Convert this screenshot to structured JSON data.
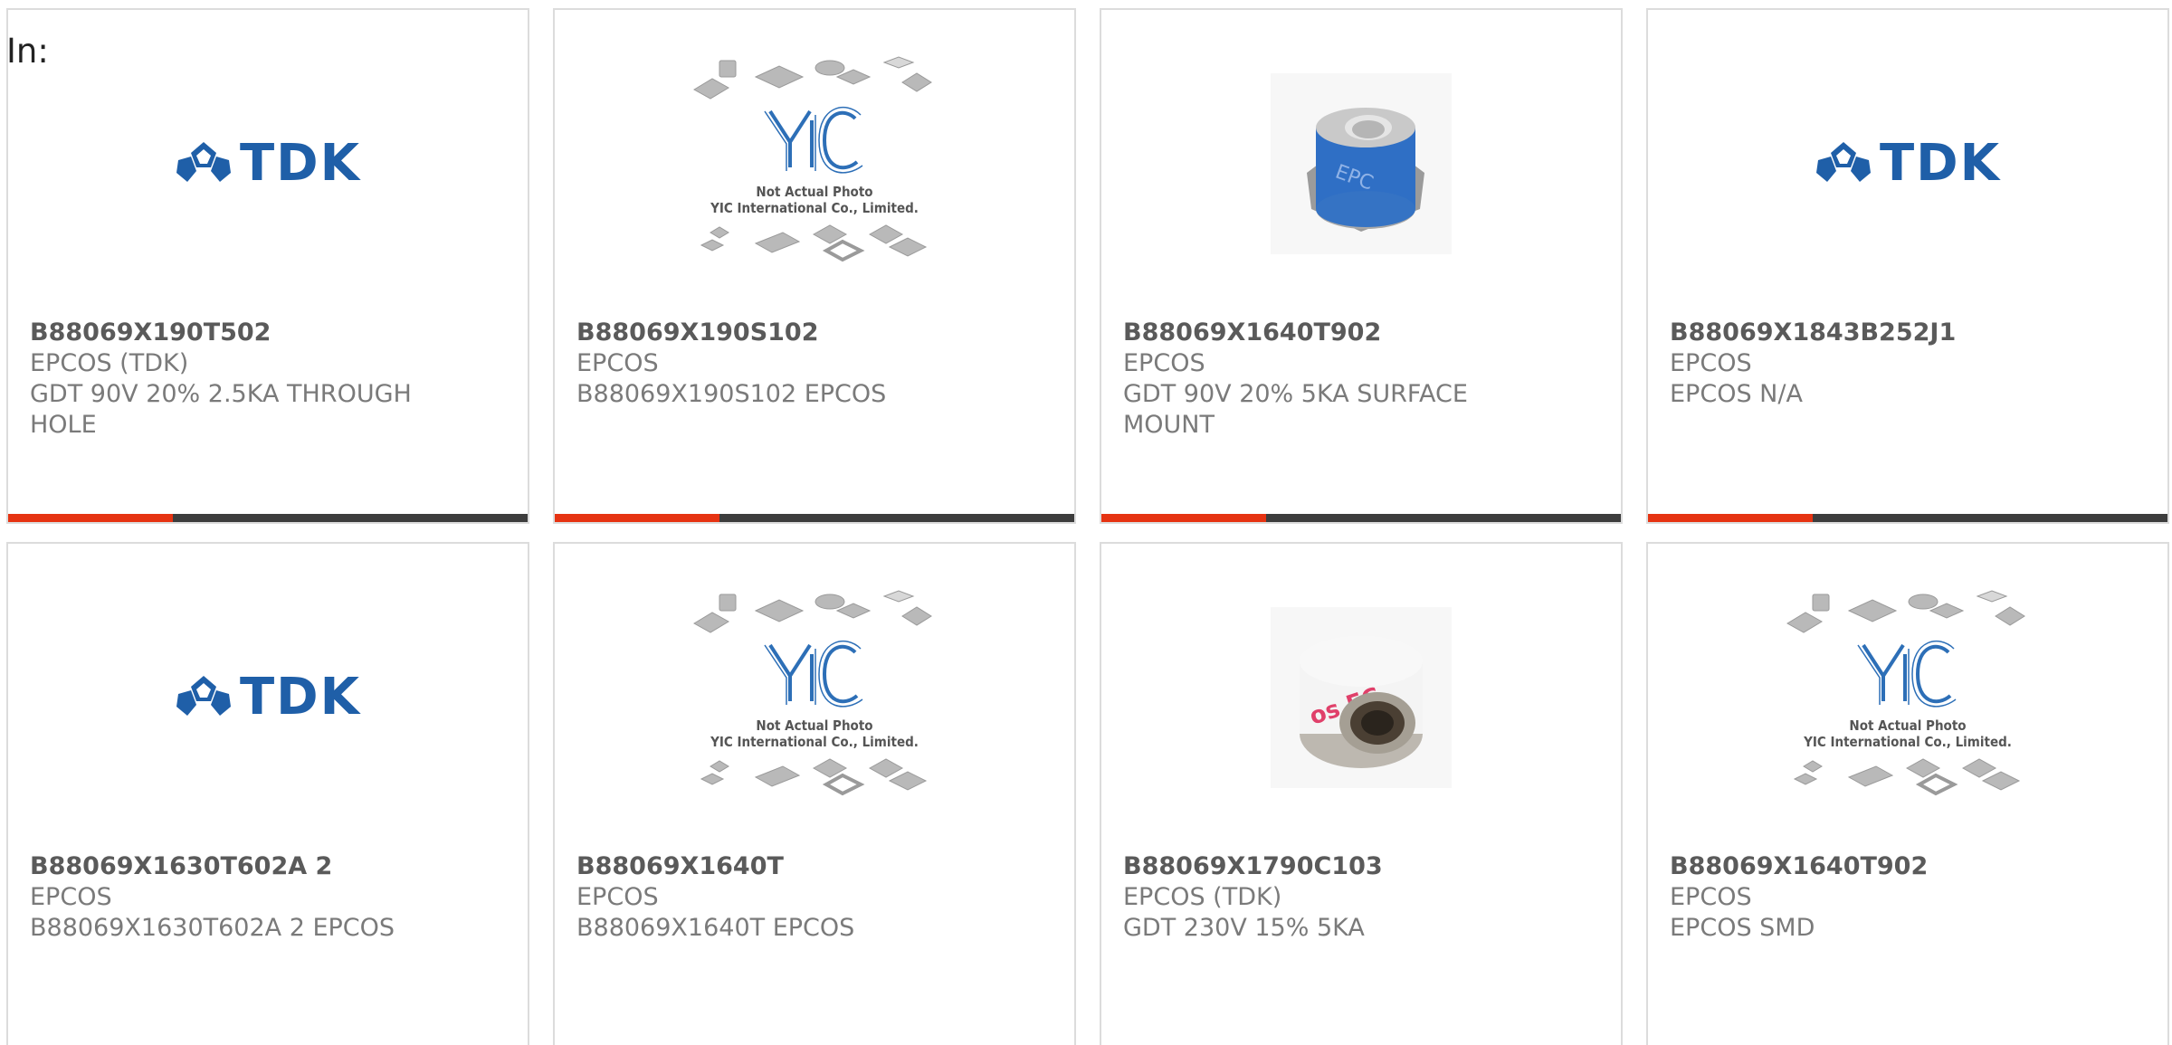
{
  "header": {
    "in_label": "In:"
  },
  "colors": {
    "accent": "#e63312",
    "bar": "#3d3d3d",
    "tdk_blue": "#1f5fa8",
    "yic_blue": "#2d6fb7"
  },
  "products": [
    {
      "part_number": "B88069X190T502",
      "manufacturer": "EPCOS (TDK)",
      "description": "GDT 90V 20% 2.5KA THROUGH HOLE",
      "image": "tdk-logo"
    },
    {
      "part_number": "B88069X190S102",
      "manufacturer": "EPCOS",
      "description": "B88069X190S102 EPCOS",
      "image": "yic-placeholder",
      "image_caption_1": "Not Actual Photo",
      "image_caption_2": "YIC International Co., Limited."
    },
    {
      "part_number": "B88069X1640T902",
      "manufacturer": "EPCOS",
      "description": "GDT 90V 20% 5KA SURFACE MOUNT",
      "image": "gdt-blue-photo"
    },
    {
      "part_number": "B88069X1843B252J1",
      "manufacturer": "EPCOS",
      "description": "EPCOS N/A",
      "image": "tdk-logo"
    },
    {
      "part_number": "B88069X1630T602A 2",
      "manufacturer": "EPCOS",
      "description": "B88069X1630T602A 2 EPCOS",
      "image": "tdk-logo"
    },
    {
      "part_number": "B88069X1640T",
      "manufacturer": "EPCOS",
      "description": "B88069X1640T EPCOS",
      "image": "yic-placeholder",
      "image_caption_1": "Not Actual Photo",
      "image_caption_2": "YIC International Co., Limited."
    },
    {
      "part_number": "B88069X1790C103",
      "manufacturer": "EPCOS (TDK)",
      "description": "GDT 230V 15% 5KA",
      "image": "gdt-white-photo"
    },
    {
      "part_number": "B88069X1640T902",
      "manufacturer": "EPCOS",
      "description": "EPCOS SMD",
      "image": "yic-placeholder",
      "image_caption_1": "Not Actual Photo",
      "image_caption_2": "YIC International Co., Limited."
    }
  ],
  "logo_text": {
    "tdk": "TDK"
  }
}
